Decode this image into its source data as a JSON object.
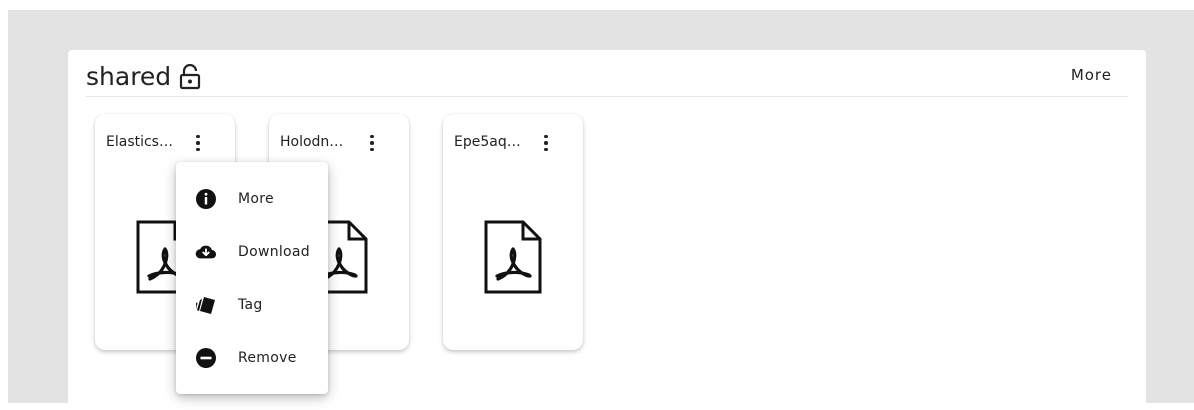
{
  "panel": {
    "title": "shared",
    "title_icon": "lock-open-icon",
    "more_label": "More"
  },
  "files": [
    {
      "name": "Elastics…",
      "icon": "pdf-file-icon"
    },
    {
      "name": "Holodn…",
      "icon": "pdf-file-icon"
    },
    {
      "name": "Epe5aq…",
      "icon": "pdf-file-icon"
    }
  ],
  "context_menu": {
    "items": [
      {
        "label": "More",
        "icon": "info-icon"
      },
      {
        "label": "Download",
        "icon": "cloud-download-icon"
      },
      {
        "label": "Tag",
        "icon": "tag-icon"
      },
      {
        "label": "Remove",
        "icon": "remove-circle-icon"
      }
    ]
  },
  "colors": {
    "background": "#e3e3e3",
    "panel": "#ffffff",
    "text": "#222222"
  }
}
